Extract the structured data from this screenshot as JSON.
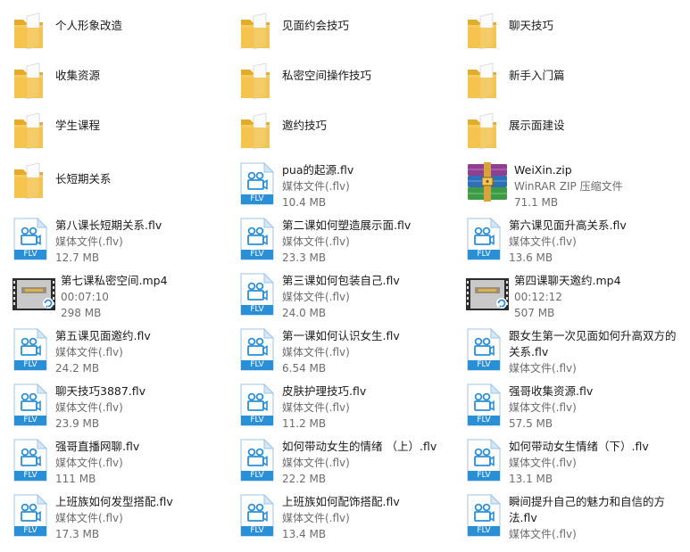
{
  "items": [
    {
      "kind": "folder",
      "name": "个人形象改造"
    },
    {
      "kind": "folder",
      "name": "见面约会技巧"
    },
    {
      "kind": "folder",
      "name": "聊天技巧"
    },
    {
      "kind": "folder",
      "name": "收集资源"
    },
    {
      "kind": "folder",
      "name": "私密空间操作技巧"
    },
    {
      "kind": "folder",
      "name": "新手入门篇"
    },
    {
      "kind": "folder",
      "name": "学生课程"
    },
    {
      "kind": "folder",
      "name": "邀约技巧"
    },
    {
      "kind": "folder",
      "name": "展示面建设"
    },
    {
      "kind": "folder",
      "name": "长短期关系"
    },
    {
      "kind": "flv",
      "name": "pua的起源.flv",
      "type": "媒体文件(.flv)",
      "size": "10.4 MB"
    },
    {
      "kind": "zip",
      "name": "WeiXin.zip",
      "type": "WinRAR ZIP 压缩文件",
      "size": "71.1 MB"
    },
    {
      "kind": "flv",
      "name": "第八课长短期关系.flv",
      "type": "媒体文件(.flv)",
      "size": "12.7 MB"
    },
    {
      "kind": "flv",
      "name": "第二课如何塑造展示面.flv",
      "type": "媒体文件(.flv)",
      "size": "23.3 MB"
    },
    {
      "kind": "flv",
      "name": "第六课见面升高关系.flv",
      "type": "媒体文件(.flv)",
      "size": "13.6 MB"
    },
    {
      "kind": "mp4",
      "name": "第七课私密空间.mp4",
      "type": "00:07:10",
      "size": "298 MB"
    },
    {
      "kind": "flv",
      "name": "第三课如何包装自己.flv",
      "type": "媒体文件(.flv)",
      "size": "24.0 MB"
    },
    {
      "kind": "mp4",
      "name": "第四课聊天邀约.mp4",
      "type": "00:12:12",
      "size": "507 MB"
    },
    {
      "kind": "flv",
      "name": "第五课见面邀约.flv",
      "type": "媒体文件(.flv)",
      "size": "24.2 MB"
    },
    {
      "kind": "flv",
      "name": "第一课如何认识女生.flv",
      "type": "媒体文件(.flv)",
      "size": "6.54 MB"
    },
    {
      "kind": "flv",
      "name": "跟女生第一次见面如何升高双方的关系.flv",
      "type": "媒体文件(.flv)",
      "size": "",
      "wrap": true
    },
    {
      "kind": "flv",
      "name": "聊天技巧3887.flv",
      "type": "媒体文件(.flv)",
      "size": "23.9 MB"
    },
    {
      "kind": "flv",
      "name": "皮肤护理技巧.flv",
      "type": "媒体文件(.flv)",
      "size": "11.2 MB"
    },
    {
      "kind": "flv",
      "name": "强哥收集资源.flv",
      "type": "媒体文件(.flv)",
      "size": "57.5 MB"
    },
    {
      "kind": "flv",
      "name": "强哥直播网聊.flv",
      "type": "媒体文件(.flv)",
      "size": "111 MB"
    },
    {
      "kind": "flv",
      "name": "如何带动女生的情绪 （上）.flv",
      "type": "媒体文件(.flv)",
      "size": "22.2 MB"
    },
    {
      "kind": "flv",
      "name": "如何带动女生情绪（下）.flv",
      "type": "媒体文件(.flv)",
      "size": "13.1 MB"
    },
    {
      "kind": "flv",
      "name": "上班族如何发型搭配.flv",
      "type": "媒体文件(.flv)",
      "size": "17.3 MB"
    },
    {
      "kind": "flv",
      "name": "上班族如何配饰搭配.flv",
      "type": "媒体文件(.flv)",
      "size": "13.4 MB"
    },
    {
      "kind": "flv",
      "name": "瞬间提升自己的魅力和自信的方法.flv",
      "type": "媒体文件(.flv)",
      "size": "",
      "wrap": true
    }
  ],
  "labels": {
    "flv_badge": "FLV"
  },
  "colors": {
    "folder": "#f3c94f",
    "flv_blue": "#2b8fd6"
  }
}
